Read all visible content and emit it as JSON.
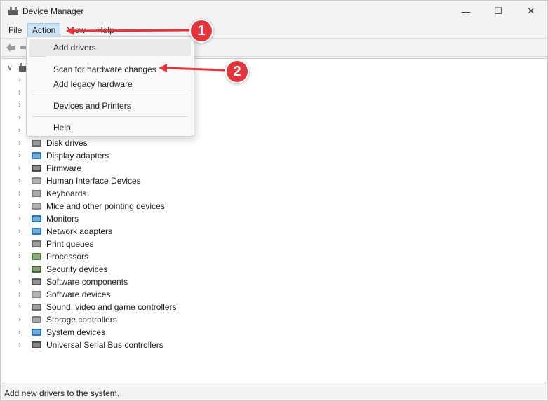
{
  "window": {
    "title": "Device Manager",
    "minimize_glyph": "—",
    "maximize_glyph": "☐",
    "close_glyph": "✕"
  },
  "menubar": {
    "items": [
      "File",
      "Action",
      "View",
      "Help"
    ]
  },
  "action_menu": {
    "items": [
      {
        "label": "Add drivers",
        "highlighted": true
      },
      {
        "label": "Scan for hardware changes"
      },
      {
        "label": "Add legacy hardware"
      },
      {
        "label": "Devices and Printers"
      },
      {
        "label": "Help"
      }
    ]
  },
  "tree": {
    "categories": [
      {
        "label": "Disk drives",
        "icon": "disk-drive-icon"
      },
      {
        "label": "Display adapters",
        "icon": "display-adapter-icon"
      },
      {
        "label": "Firmware",
        "icon": "firmware-icon"
      },
      {
        "label": "Human Interface Devices",
        "icon": "hid-icon"
      },
      {
        "label": "Keyboards",
        "icon": "keyboard-icon"
      },
      {
        "label": "Mice and other pointing devices",
        "icon": "mouse-icon"
      },
      {
        "label": "Monitors",
        "icon": "monitor-icon"
      },
      {
        "label": "Network adapters",
        "icon": "network-adapter-icon"
      },
      {
        "label": "Print queues",
        "icon": "printer-icon"
      },
      {
        "label": "Processors",
        "icon": "processor-icon"
      },
      {
        "label": "Security devices",
        "icon": "security-device-icon"
      },
      {
        "label": "Software components",
        "icon": "software-component-icon"
      },
      {
        "label": "Software devices",
        "icon": "software-device-icon"
      },
      {
        "label": "Sound, video and game controllers",
        "icon": "speaker-icon"
      },
      {
        "label": "Storage controllers",
        "icon": "storage-controller-icon"
      },
      {
        "label": "System devices",
        "icon": "system-device-icon"
      },
      {
        "label": "Universal Serial Bus controllers",
        "icon": "usb-icon"
      }
    ]
  },
  "statusbar": {
    "text": "Add new drivers to the system."
  },
  "annotations": {
    "badge_1": "1",
    "badge_2": "2",
    "color": "#e2343a"
  }
}
